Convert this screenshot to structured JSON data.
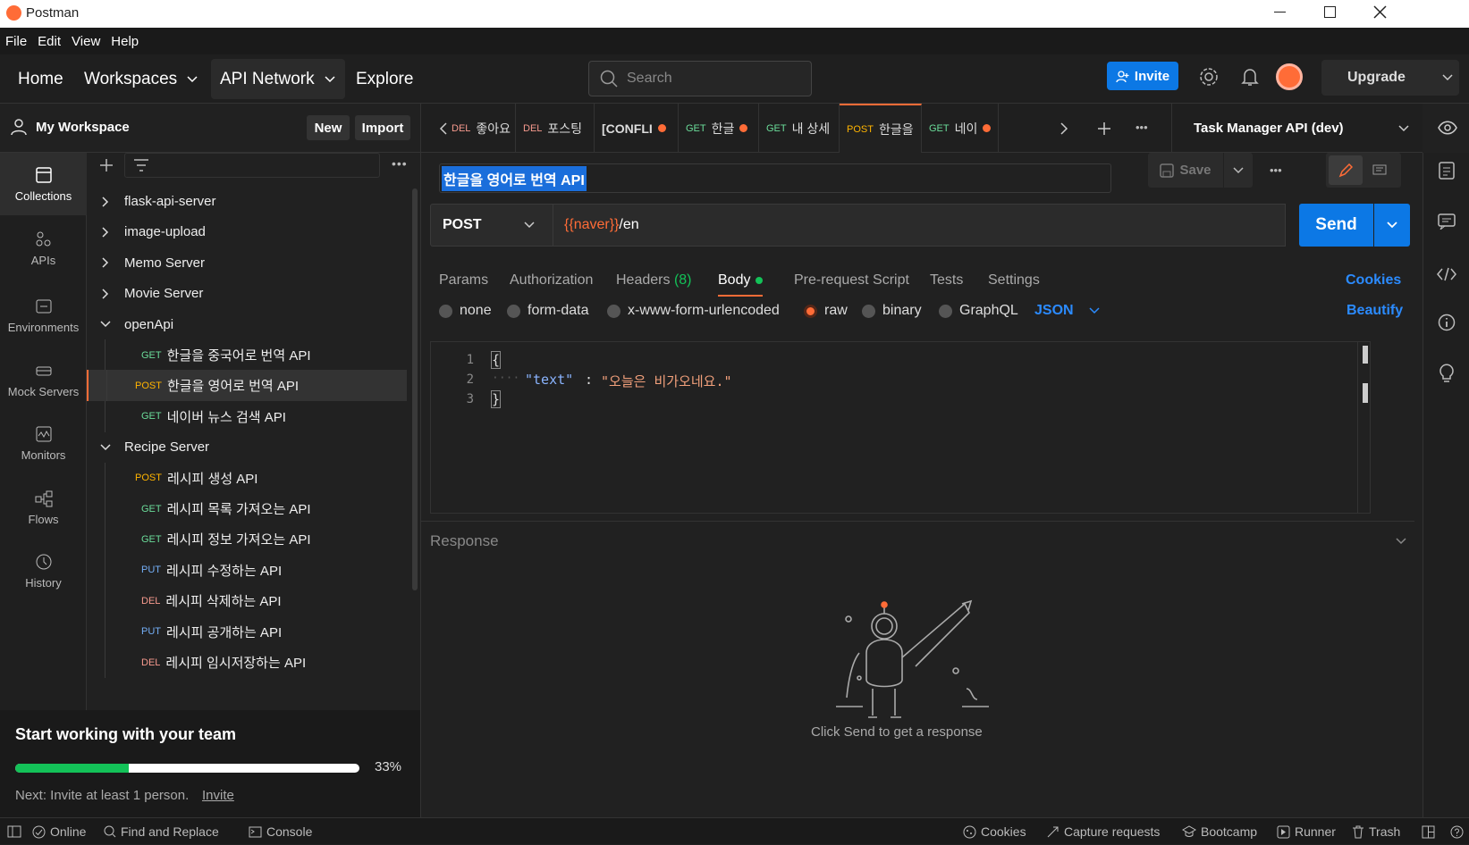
{
  "window": {
    "title": "Postman"
  },
  "menu": [
    "File",
    "Edit",
    "View",
    "Help"
  ],
  "nav": {
    "home": "Home",
    "workspaces": "Workspaces",
    "api_network": "API Network",
    "explore": "Explore",
    "search_placeholder": "Search",
    "invite": "Invite",
    "upgrade": "Upgrade"
  },
  "workspace": {
    "name": "My Workspace",
    "new": "New",
    "import": "Import"
  },
  "rail": [
    "Collections",
    "APIs",
    "Environments",
    "Mock Servers",
    "Monitors",
    "Flows",
    "History"
  ],
  "tree": [
    {
      "kind": "folder",
      "label": "flask-api-server",
      "open": false
    },
    {
      "kind": "folder",
      "label": "image-upload",
      "open": false
    },
    {
      "kind": "folder",
      "label": "Memo Server",
      "open": false
    },
    {
      "kind": "folder",
      "label": "Movie Server",
      "open": false
    },
    {
      "kind": "folder",
      "label": "openApi",
      "open": true
    },
    {
      "kind": "req",
      "method": "GET",
      "label": "한글을 중국어로 번역 API"
    },
    {
      "kind": "req",
      "method": "POST",
      "label": "한글을 영어로 번역 API",
      "selected": true
    },
    {
      "kind": "req",
      "method": "GET",
      "label": "네이버 뉴스 검색 API"
    },
    {
      "kind": "folder",
      "label": "Recipe Server",
      "open": true
    },
    {
      "kind": "req",
      "method": "POST",
      "label": "레시피 생성 API"
    },
    {
      "kind": "req",
      "method": "GET",
      "label": "레시피 목록 가져오는 API"
    },
    {
      "kind": "req",
      "method": "GET",
      "label": "레시피 정보 가져오는 API"
    },
    {
      "kind": "req",
      "method": "PUT",
      "label": "레시피 수정하는 API"
    },
    {
      "kind": "req",
      "method": "DEL",
      "label": "레시피 삭제하는 API"
    },
    {
      "kind": "req",
      "method": "PUT",
      "label": "레시피 공개하는 API"
    },
    {
      "kind": "req",
      "method": "DEL",
      "label": "레시피 임시저장하는 API"
    }
  ],
  "promo": {
    "title": "Start working with your team",
    "progress_text": "33%",
    "progress": 0.33,
    "next": "Next: Invite at least 1 person.",
    "invite_link": "Invite"
  },
  "tabs": [
    {
      "method": "DEL",
      "label": "좋아요",
      "dot": false
    },
    {
      "method": "DEL",
      "label": "포스팅",
      "dot": false
    },
    {
      "method": "",
      "label": "[CONFLI",
      "dot": true
    },
    {
      "method": "GET",
      "label": "한글",
      "dot": true
    },
    {
      "method": "GET",
      "label": "내 상세",
      "dot": false
    },
    {
      "method": "POST",
      "label": "한글을",
      "dot": false,
      "active": true
    },
    {
      "method": "GET",
      "label": "네이",
      "dot": true
    }
  ],
  "environment": "Task Manager API (dev)",
  "request": {
    "name": "한글을 영어로 번역 API",
    "save": "Save",
    "method": "POST",
    "url_var": "{{naver}}",
    "url_path": "/en",
    "send": "Send",
    "tabs": [
      "Params",
      "Authorization",
      "Headers",
      "Body",
      "Pre-request Script",
      "Tests",
      "Settings"
    ],
    "headers_count": "(8)",
    "cookies": "Cookies",
    "body_types": [
      "none",
      "form-data",
      "x-www-form-urlencoded",
      "raw",
      "binary",
      "GraphQL"
    ],
    "body_format": "JSON",
    "beautify": "Beautify",
    "code": {
      "open": "{",
      "key": "\"text\"",
      "colon": ":",
      "value": "\"오늘은 비가오네요.\"",
      "close": "}"
    }
  },
  "response": {
    "title": "Response",
    "hint": "Click Send to get a response"
  },
  "status": {
    "online": "Online",
    "find": "Find and Replace",
    "console": "Console",
    "cookies": "Cookies",
    "capture": "Capture requests",
    "bootcamp": "Bootcamp",
    "runner": "Runner",
    "trash": "Trash"
  },
  "colors": {
    "accent": "#ff6c37",
    "primary": "#0c78e5",
    "bg": "#212121"
  }
}
